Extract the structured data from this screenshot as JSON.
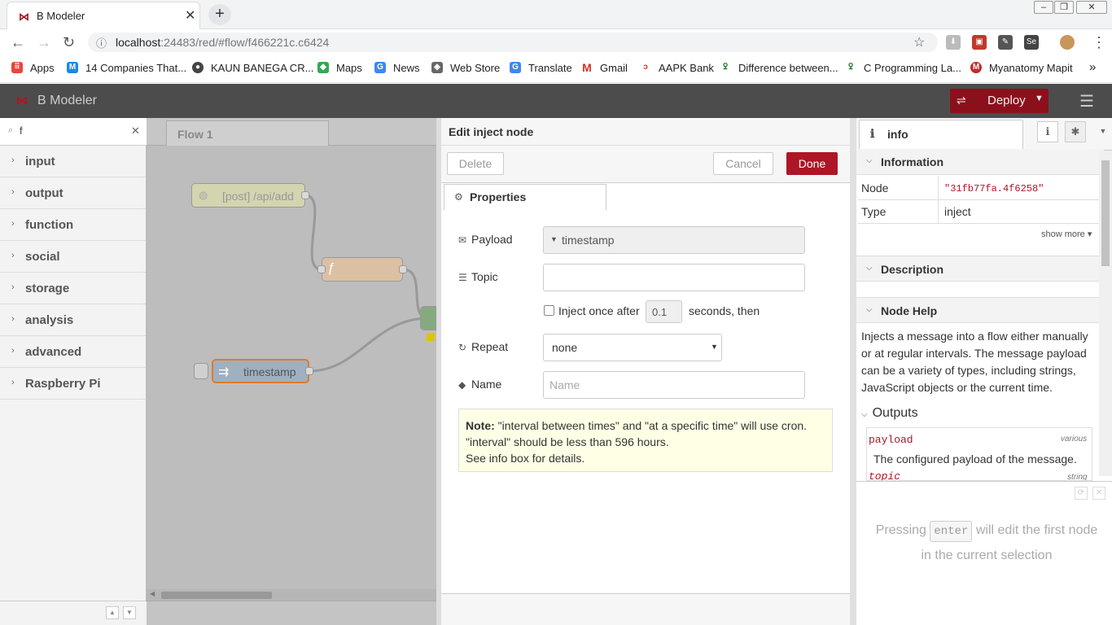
{
  "browser": {
    "tab_title": "B Modeler",
    "tab_close": "✕",
    "new_tab": "+",
    "url_host": "localhost",
    "url_rest": ":24483/red/#flow/f466221c.c6424",
    "bookmarks": [
      "Apps",
      "14 Companies That...",
      "KAUN BANEGA CR...",
      "Maps",
      "News",
      "Web Store",
      "Translate",
      "Gmail",
      "AAPK Bank",
      "Difference between...",
      "C Programming La...",
      "Myanatomy Mapit"
    ],
    "overflow": "»"
  },
  "app": {
    "title": "B Modeler",
    "deploy_label": "Deploy"
  },
  "palette": {
    "search_value": "f",
    "categories": [
      "input",
      "output",
      "function",
      "social",
      "storage",
      "analysis",
      "advanced",
      "Raspberry Pi"
    ]
  },
  "workspace": {
    "flow_tab": "Flow 1",
    "nodes": {
      "http_in": "[post] /api/add",
      "function": "ƒ",
      "inject": "timestamp"
    }
  },
  "editor": {
    "title": "Edit inject node",
    "delete_label": "Delete",
    "cancel_label": "Cancel",
    "done_label": "Done",
    "properties_tab": "Properties",
    "payload_label": "Payload",
    "payload_value": "timestamp",
    "topic_label": "Topic",
    "topic_value": "",
    "once_label": "Inject once after",
    "once_delay": "0.1",
    "seconds_label": "seconds, then",
    "repeat_label": "Repeat",
    "repeat_value": "none",
    "name_label": "Name",
    "name_placeholder": "Name",
    "note_bold": "Note:",
    "note_line1": " \"interval between times\" and \"at a specific time\" will use cron.",
    "note_line2": "\"interval\" should be less than 596 hours.",
    "note_line3": "See info box for details."
  },
  "sidebar": {
    "tab_label": "info",
    "information_header": "Information",
    "node_key": "Node",
    "node_value": "\"31fb77fa.4f6258\"",
    "type_key": "Type",
    "type_value": "inject",
    "show_more": "show more ▾",
    "description_header": "Description",
    "help_header": "Node Help",
    "help_text": "Injects a message into a flow either manually or at regular intervals. The message payload can be a variety of types, including strings, JavaScript objects or the current time.",
    "outputs_header": "Outputs",
    "output_payload_name": "payload",
    "output_payload_type": "various",
    "output_payload_desc": "The configured payload of the message.",
    "output_topic_name": "topic",
    "output_topic_type": "string",
    "tip_pre": "Pressing ",
    "tip_key": "enter",
    "tip_post": " will edit the first node in the current selection"
  },
  "colors": {
    "accent": "#ad1625",
    "header_bg": "#4c4c4c",
    "deploy_bg": "#8c101c",
    "http_node": "#d9d9a6",
    "function_node": "#e4c5a5",
    "inject_node": "#a6bbcf",
    "selected_outline": "#ff7f0e"
  }
}
